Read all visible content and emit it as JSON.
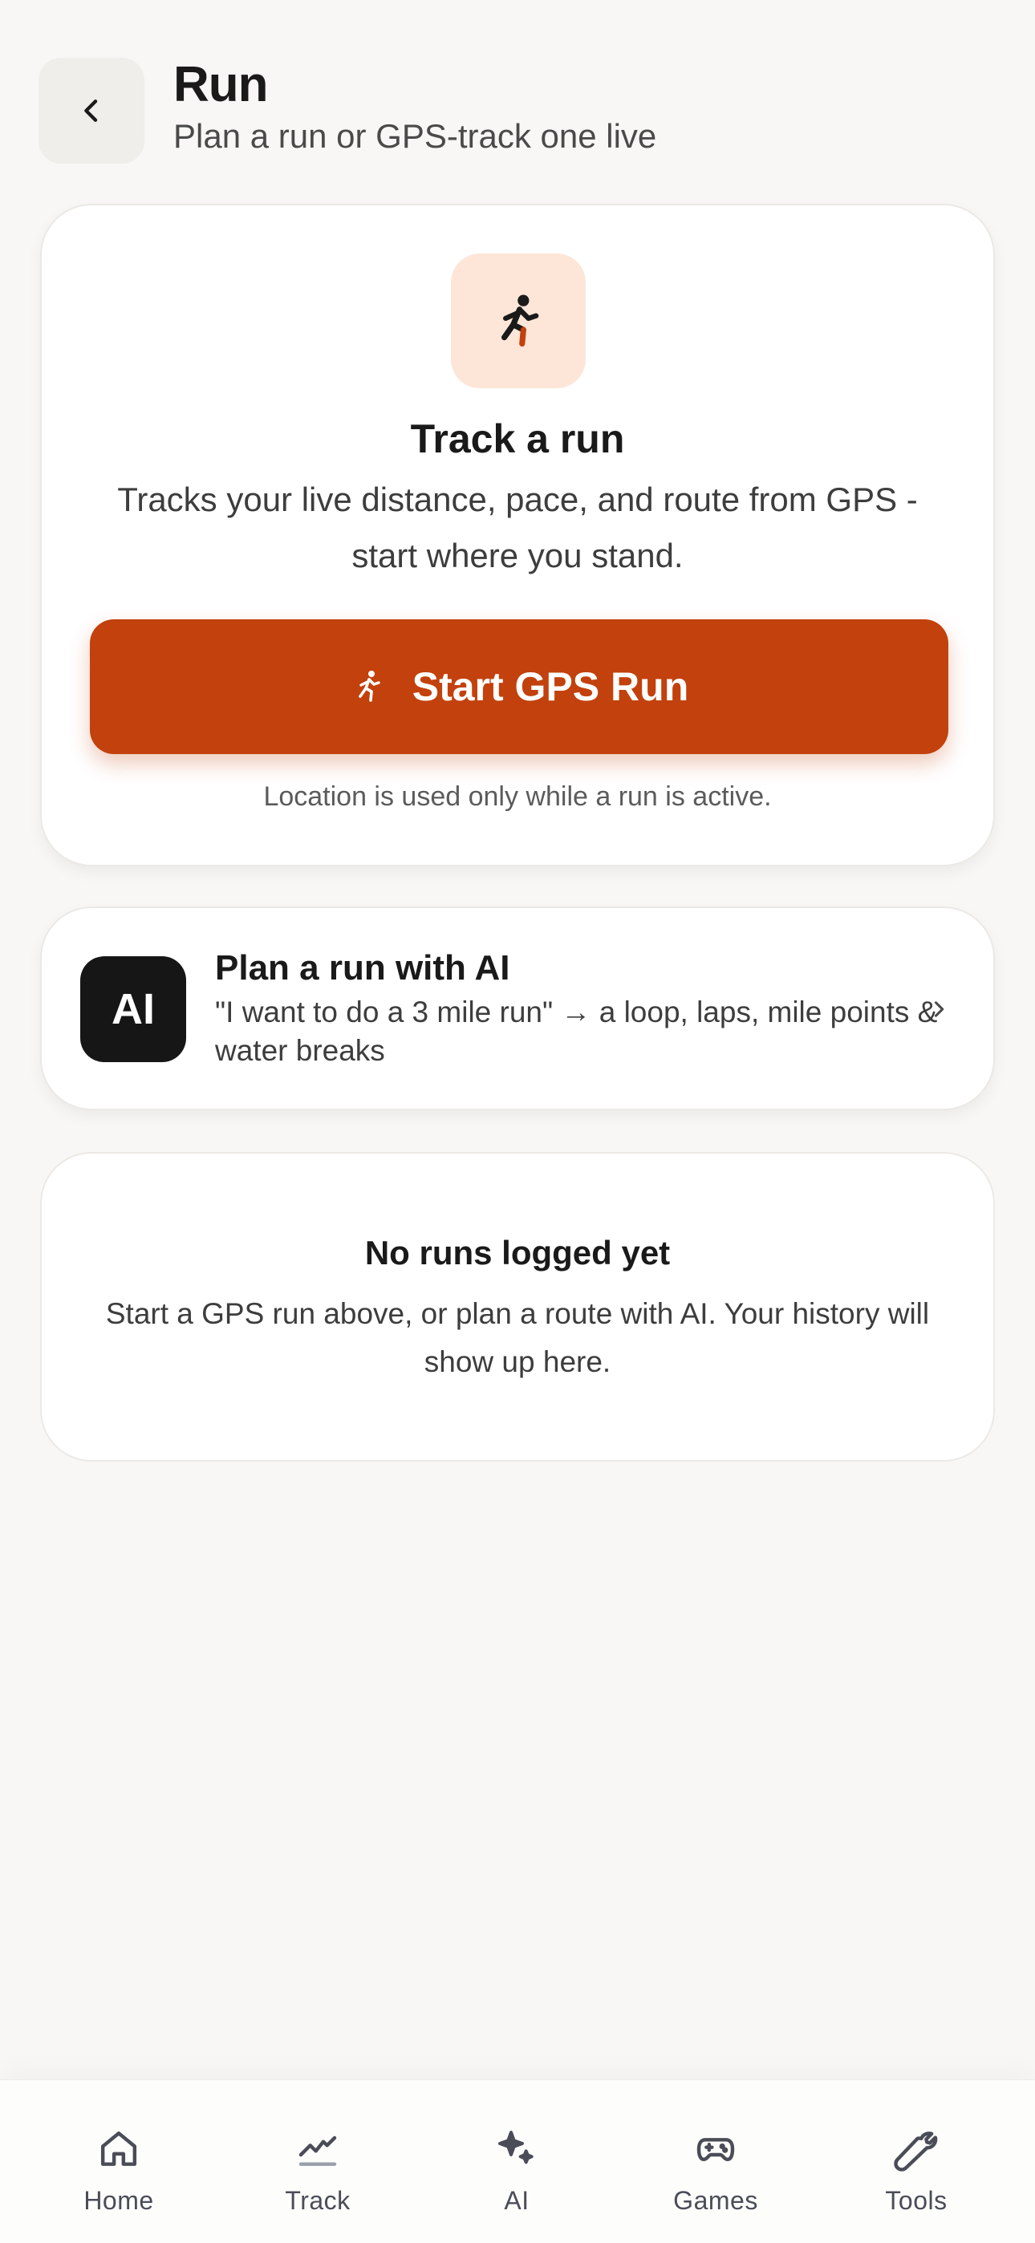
{
  "header": {
    "title": "Run",
    "subtitle": "Plan a run or GPS-track one live"
  },
  "track_card": {
    "icon": "running-person-icon",
    "title": "Track a run",
    "description": "Tracks your live distance, pace, and route from GPS - start where you stand.",
    "start_button_label": "Start GPS Run",
    "location_note": "Location is used only while a run is active."
  },
  "plan_card": {
    "badge": "AI",
    "title": "Plan a run with AI",
    "description": "\"I want to do a 3 mile run\" → a loop, laps, mile points & water breaks"
  },
  "empty_state": {
    "title": "No runs logged yet",
    "description": "Start a GPS run above, or plan a route with AI. Your history will show up here."
  },
  "bottom_nav": {
    "items": [
      {
        "label": "Home",
        "icon": "home-icon"
      },
      {
        "label": "Track",
        "icon": "trend-line-icon"
      },
      {
        "label": "AI",
        "icon": "sparkles-icon"
      },
      {
        "label": "Games",
        "icon": "gamepad-icon"
      },
      {
        "label": "Tools",
        "icon": "wrench-icon"
      }
    ]
  },
  "colors": {
    "accent": "#c2410c",
    "accent_soft": "#fde6d8",
    "background": "#f8f7f5",
    "ai_badge": "#161616"
  }
}
